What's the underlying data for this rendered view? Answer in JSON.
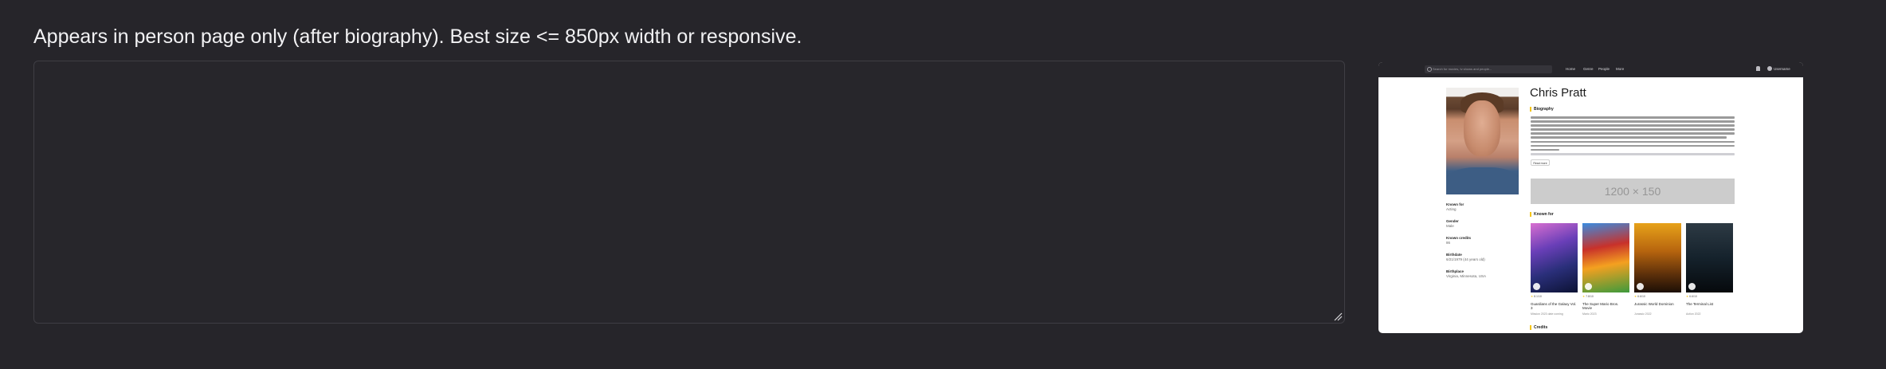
{
  "heading": "Appears in person page only (after biography). Best size <= 850px width or responsive.",
  "code_area": {
    "value": ""
  },
  "preview": {
    "search_placeholder": "Search for movies, tv shows and people...",
    "nav": [
      "Home",
      "Genre",
      "People",
      "More"
    ],
    "user_name": "Username",
    "person_name": "Chris Pratt",
    "biography_label": "Biography",
    "read_more_label": "Read more",
    "ad_placeholder": "1200 × 150",
    "known_for_label": "Known for",
    "credits_label": "Credits",
    "side_info": [
      {
        "label": "Known for",
        "value": "Acting"
      },
      {
        "label": "Gender",
        "value": "Male"
      },
      {
        "label": "Known credits",
        "value": "86"
      },
      {
        "label": "Birthdate",
        "value": "6/21/1979 (44 years old)"
      },
      {
        "label": "Birthplace",
        "value": "Virginia, Minnesota, USA"
      }
    ],
    "movies": [
      {
        "rating": "8.1/10",
        "title": "Guardians of the Galaxy Vol. 3",
        "year": "Mission 2023 date coming"
      },
      {
        "rating": "7.8/10",
        "title": "The Super Mario Bros. Movie",
        "year": "Mario 2023"
      },
      {
        "rating": "6.6/10",
        "title": "Jurassic World Dominion",
        "year": "Jurassic 2022"
      },
      {
        "rating": "6.6/10",
        "title": "The Terminal List",
        "year": "Action 2022"
      }
    ]
  }
}
